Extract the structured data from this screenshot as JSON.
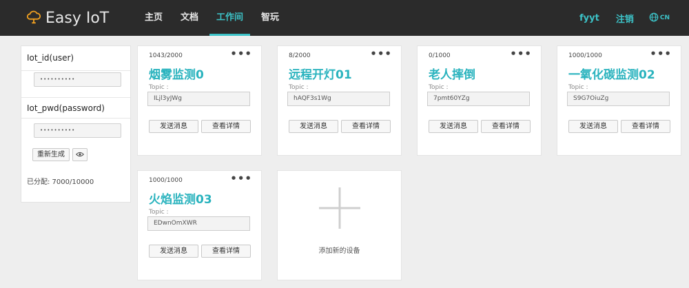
{
  "app": {
    "name": "Easy IoT"
  },
  "nav": {
    "items": [
      {
        "label": "主页",
        "active": false
      },
      {
        "label": "文档",
        "active": false
      },
      {
        "label": "工作间",
        "active": true
      },
      {
        "label": "智玩",
        "active": false
      }
    ],
    "user": "fyyt",
    "logout": "注销",
    "lang": "CN"
  },
  "sidebar": {
    "iot_id_label": "Iot_id(user)",
    "iot_id_value": "••••••••••",
    "iot_pwd_label": "Iot_pwd(password)",
    "iot_pwd_value": "••••••••••",
    "regenerate": "重新生成",
    "allocated": "已分配: 7000/10000"
  },
  "card_common": {
    "topic_label": "Topic :",
    "send_button": "发送消息",
    "detail_button": "查看详情",
    "menu": "•••"
  },
  "devices": [
    {
      "count": "1043/2000",
      "name": "烟雾监测0",
      "topic": "ILjl3yJWg"
    },
    {
      "count": "8/2000",
      "name": "远程开灯01",
      "topic": "hAQF3s1Wg"
    },
    {
      "count": "0/1000",
      "name": "老人摔倒",
      "topic": "7pmt60YZg"
    },
    {
      "count": "1000/1000",
      "name": "一氧化碳监测02",
      "topic": "S9G7OiuZg"
    },
    {
      "count": "1000/1000",
      "name": "火焰监测03",
      "topic": "EDwnOmXWR"
    }
  ],
  "add_device": {
    "label": "添加新的设备"
  },
  "colors": {
    "accent": "#3cc2c7",
    "nav_bg": "#2b2b2b",
    "title": "#2ab3be"
  }
}
